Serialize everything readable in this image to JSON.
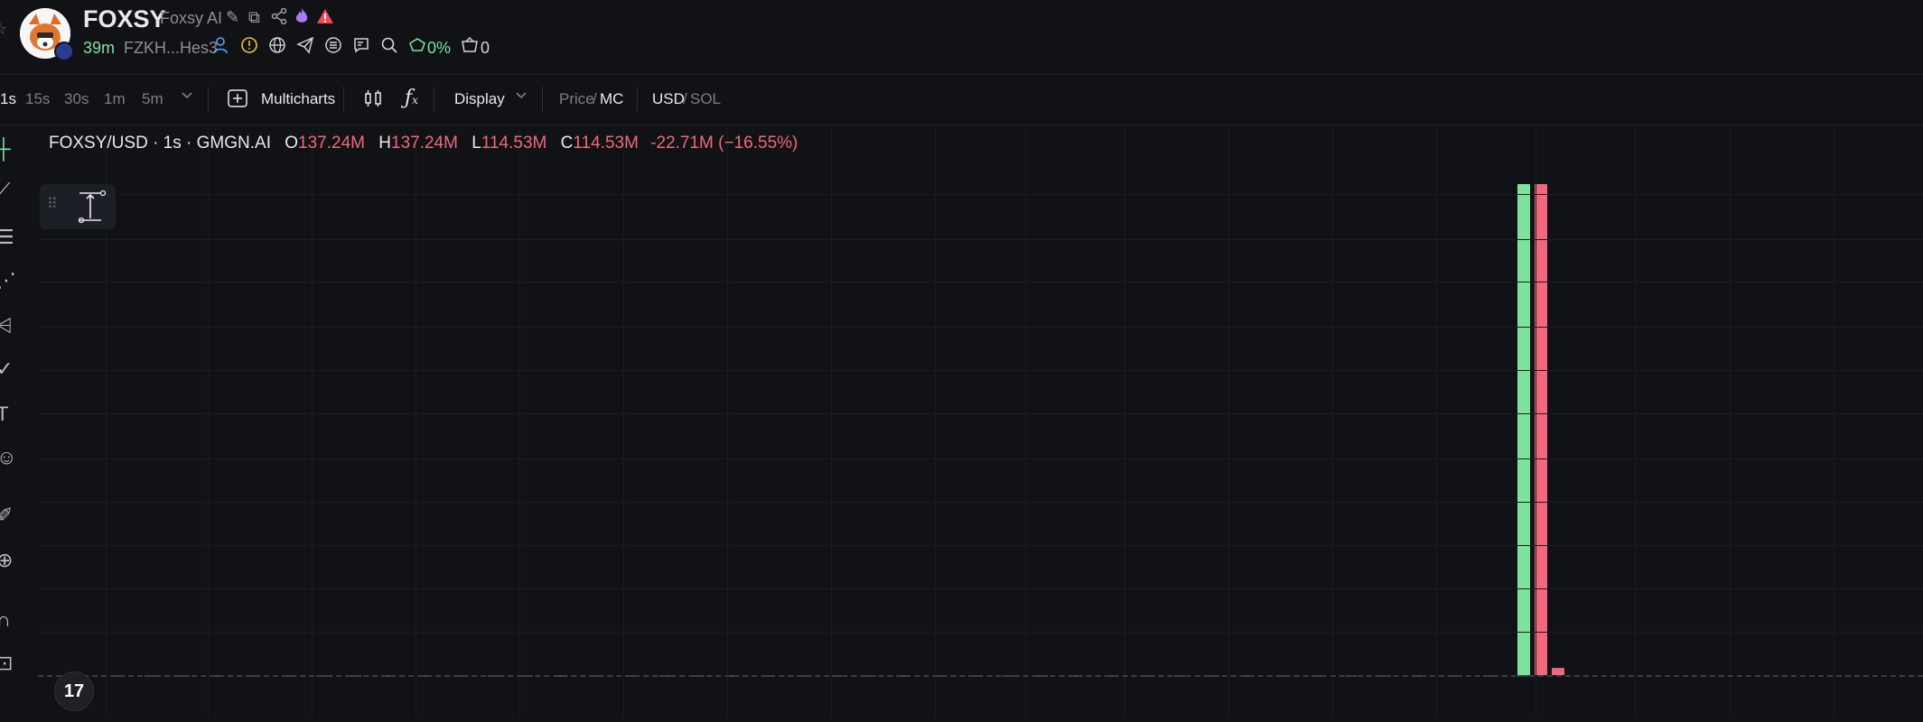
{
  "header": {
    "symbol": "FOXSY",
    "name": "Foxsy AI",
    "age": "39m",
    "address": "FZKH...Hes3",
    "holder_pct": "0%",
    "count": "0"
  },
  "toolbar": {
    "intervals": [
      "1s",
      "15s",
      "30s",
      "1m",
      "5m"
    ],
    "active_interval": "1s",
    "multicharts": "Multicharts",
    "display": "Display",
    "price": "Price",
    "slash1": "/",
    "mc": "MC",
    "usd": "USD",
    "slash2": "/",
    "sol": "SOL"
  },
  "legend": {
    "title": "FOXSY/USD · 1s · GMGN.AI",
    "o_label": "O",
    "o": "137.24M",
    "h_label": "H",
    "h": "137.24M",
    "l_label": "L",
    "l": "114.53M",
    "c_label": "C",
    "c": "114.53M",
    "change": "-22.71M (−16.55%)"
  },
  "tv_logo": "17",
  "colors": {
    "up": "#7ee29c",
    "down": "#f0677e",
    "bg": "#111215"
  },
  "icons": {
    "header": [
      "edit-icon",
      "copy-icon",
      "share-icon",
      "fire-icon",
      "warning-icon"
    ],
    "row2": [
      "user-icon",
      "info-icon",
      "globe-icon",
      "telegram-icon",
      "list-icon",
      "message-icon",
      "search-icon",
      "crown-icon",
      "basket-icon"
    ],
    "left_tools": [
      "crosshair-icon",
      "trendline-icon",
      "fib-icon",
      "pattern-icon",
      "projection-icon",
      "brush-icon",
      "text-icon",
      "emoji-icon",
      "ruler-icon",
      "zoom-icon",
      "magnet-icon",
      "lock-icon"
    ]
  },
  "chart_data": {
    "type": "candlestick",
    "description_of_axis": "",
    "candles": [
      {
        "o": 0,
        "h": 137.24,
        "l": 0,
        "c": 137.24,
        "color": "up"
      },
      {
        "o": 137.24,
        "h": 137.24,
        "l": 0,
        "c": 0,
        "color": "down"
      },
      {
        "o": 2,
        "h": 2,
        "l": 0,
        "c": 0,
        "color": "down"
      }
    ],
    "ohlc_last": {
      "o": "137.24M",
      "h": "137.24M",
      "l": "114.53M",
      "c": "114.53M"
    }
  }
}
